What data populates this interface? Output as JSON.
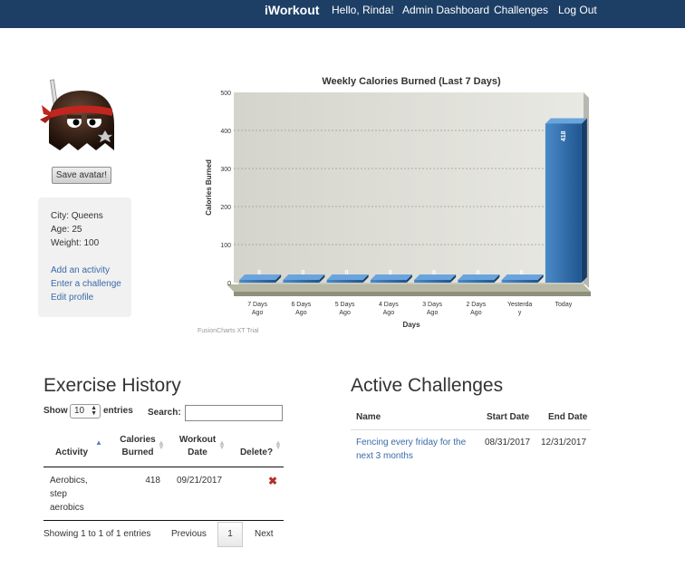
{
  "nav": {
    "brand": "iWorkout",
    "greeting": "Hello, Rinda!",
    "admin": "Admin Dashboard",
    "challenges": "Challenges",
    "logout": "Log Out"
  },
  "avatar": {
    "save_label": "Save avatar!"
  },
  "profile": {
    "city": "City: Queens",
    "age": "Age: 25",
    "weight": "Weight: 100",
    "links": [
      "Add an activity",
      "Enter a challenge",
      "Edit profile"
    ]
  },
  "chart_data": {
    "type": "bar",
    "title": "Weekly Calories Burned (Last 7 Days)",
    "xlabel": "Days",
    "ylabel": "Calories Burned",
    "categories": [
      [
        "7 Days",
        "Ago"
      ],
      [
        "6 Days",
        "Ago"
      ],
      [
        "5 Days",
        "Ago"
      ],
      [
        "4 Days",
        "Ago"
      ],
      [
        "3 Days",
        "Ago"
      ],
      [
        "2 Days",
        "Ago"
      ],
      [
        "Yesterda",
        "y"
      ],
      [
        "Today"
      ]
    ],
    "values": [
      0,
      0,
      0,
      0,
      0,
      0,
      0,
      418
    ],
    "ylim": [
      0,
      500
    ],
    "yticks": [
      0,
      100,
      200,
      300,
      400,
      500
    ],
    "grid": true,
    "legend": "none",
    "bar_color": "#2f6aa6",
    "trial_text": "FusionCharts XT Trial"
  },
  "exercise_history": {
    "title": "Exercise History",
    "show_label": "Show",
    "entries_value": "10",
    "entries_label": "entries",
    "search_label": "Search:",
    "search_value": "",
    "headers": {
      "activity": "Activity",
      "calories": [
        "Calories",
        "Burned"
      ],
      "date": [
        "Workout",
        "Date"
      ],
      "delete": "Delete?"
    },
    "rows": [
      {
        "activity": [
          "Aerobics,",
          "step",
          "aerobics"
        ],
        "calories": "418",
        "date": "09/21/2017",
        "delete_icon": "close-icon"
      }
    ],
    "info": "Showing 1 to 1 of 1 entries",
    "prev": "Previous",
    "page": "1",
    "next": "Next"
  },
  "active_challenges": {
    "title": "Active Challenges",
    "headers": {
      "name": "Name",
      "start": "Start Date",
      "end": "End Date"
    },
    "rows": [
      {
        "name": "Fencing every friday for the next 3 months",
        "start": "08/31/2017",
        "end": "12/31/2017"
      }
    ]
  }
}
